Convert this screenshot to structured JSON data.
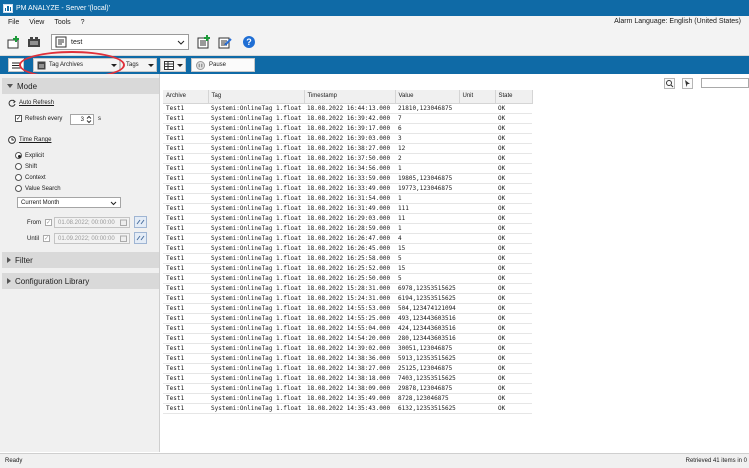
{
  "window": {
    "title": "PM ANALYZE - Server '(local)'"
  },
  "menu": {
    "items": [
      "File",
      "View",
      "Tools",
      "?"
    ],
    "alarm_language": "Alarm Language: English (United States)"
  },
  "toolbar": {
    "project_combo_value": "test"
  },
  "toolbar2": {
    "source_dropdown": "Tag Archives",
    "tags_dropdown": "Tags",
    "pause_label": "Pause"
  },
  "mode_panel": {
    "header": "Mode",
    "auto_refresh": "Auto Refresh",
    "refresh_every_label": "Refresh every",
    "refresh_value": "3",
    "refresh_unit": "s",
    "time_range": "Time Range",
    "options": [
      "Explicit",
      "Shift",
      "Context",
      "Value Search"
    ],
    "selected_option": "Explicit",
    "range_preset": "Current Month",
    "from_label": "From",
    "from_value": "01.08.2022; 00:00:00",
    "until_label": "Until",
    "until_value": "01.09.2022; 00:00:00"
  },
  "filter_panel": {
    "header": "Filter"
  },
  "config_panel": {
    "header": "Configuration Library"
  },
  "table": {
    "columns": [
      "Archive",
      "Tag",
      "Timestamp",
      "Value",
      "Unit",
      "State"
    ],
    "rows": [
      [
        "Test1",
        "Systemi:OnlineTag 1.float",
        "18.08.2022 16:44:13.000",
        "21810,123046875",
        "",
        "OK"
      ],
      [
        "Test1",
        "Systemi:OnlineTag 1.float",
        "18.08.2022 16:39:42.000",
        "7",
        "",
        "OK"
      ],
      [
        "Test1",
        "Systemi:OnlineTag 1.float",
        "18.08.2022 16:39:17.000",
        "6",
        "",
        "OK"
      ],
      [
        "Test1",
        "Systemi:OnlineTag 1.float",
        "18.08.2022 16:39:03.000",
        "3",
        "",
        "OK"
      ],
      [
        "Test1",
        "Systemi:OnlineTag 1.float",
        "18.08.2022 16:38:27.000",
        "12",
        "",
        "OK"
      ],
      [
        "Test1",
        "Systemi:OnlineTag 1.float",
        "18.08.2022 16:37:50.000",
        "2",
        "",
        "OK"
      ],
      [
        "Test1",
        "Systemi:OnlineTag 1.float",
        "18.08.2022 16:34:56.000",
        "1",
        "",
        "OK"
      ],
      [
        "Test1",
        "Systemi:OnlineTag 1.float",
        "18.08.2022 16:33:59.000",
        "19805,123046875",
        "",
        "OK"
      ],
      [
        "Test1",
        "Systemi:OnlineTag 1.float",
        "18.08.2022 16:33:49.000",
        "19773,123046875",
        "",
        "OK"
      ],
      [
        "Test1",
        "Systemi:OnlineTag 1.float",
        "18.08.2022 16:31:54.000",
        "1",
        "",
        "OK"
      ],
      [
        "Test1",
        "Systemi:OnlineTag 1.float",
        "18.08.2022 16:31:49.000",
        "111",
        "",
        "OK"
      ],
      [
        "Test1",
        "Systemi:OnlineTag 1.float",
        "18.08.2022 16:29:03.000",
        "11",
        "",
        "OK"
      ],
      [
        "Test1",
        "Systemi:OnlineTag 1.float",
        "18.08.2022 16:28:59.000",
        "1",
        "",
        "OK"
      ],
      [
        "Test1",
        "Systemi:OnlineTag 1.float",
        "18.08.2022 16:26:47.000",
        "4",
        "",
        "OK"
      ],
      [
        "Test1",
        "Systemi:OnlineTag 1.float",
        "18.08.2022 16:26:45.000",
        "15",
        "",
        "OK"
      ],
      [
        "Test1",
        "Systemi:OnlineTag 1.float",
        "18.08.2022 16:25:58.000",
        "5",
        "",
        "OK"
      ],
      [
        "Test1",
        "Systemi:OnlineTag 1.float",
        "18.08.2022 16:25:52.000",
        "15",
        "",
        "OK"
      ],
      [
        "Test1",
        "Systemi:OnlineTag 1.float",
        "18.08.2022 16:25:50.000",
        "5",
        "",
        "OK"
      ],
      [
        "Test1",
        "Systemi:OnlineTag 1.float",
        "18.08.2022 15:28:31.000",
        "6978,12353515625",
        "",
        "OK"
      ],
      [
        "Test1",
        "Systemi:OnlineTag 1.float",
        "18.08.2022 15:24:31.000",
        "6194,12353515625",
        "",
        "OK"
      ],
      [
        "Test1",
        "Systemi:OnlineTag 1.float",
        "18.08.2022 14:55:53.000",
        "504,123474121094",
        "",
        "OK"
      ],
      [
        "Test1",
        "Systemi:OnlineTag 1.float",
        "18.08.2022 14:55:25.000",
        "493,123443603516",
        "",
        "OK"
      ],
      [
        "Test1",
        "Systemi:OnlineTag 1.float",
        "18.08.2022 14:55:04.000",
        "424,123443603516",
        "",
        "OK"
      ],
      [
        "Test1",
        "Systemi:OnlineTag 1.float",
        "18.08.2022 14:54:20.000",
        "280,123443603516",
        "",
        "OK"
      ],
      [
        "Test1",
        "Systemi:OnlineTag 1.float",
        "18.08.2022 14:39:02.000",
        "30051,123046875",
        "",
        "OK"
      ],
      [
        "Test1",
        "Systemi:OnlineTag 1.float",
        "18.08.2022 14:38:36.000",
        "5913,12353515625",
        "",
        "OK"
      ],
      [
        "Test1",
        "Systemi:OnlineTag 1.float",
        "18.08.2022 14:38:27.000",
        "25125,123046875",
        "",
        "OK"
      ],
      [
        "Test1",
        "Systemi:OnlineTag 1.float",
        "18.08.2022 14:38:18.000",
        "7403,12353515625",
        "",
        "OK"
      ],
      [
        "Test1",
        "Systemi:OnlineTag 1.float",
        "18.08.2022 14:38:09.000",
        "29878,123046875",
        "",
        "OK"
      ],
      [
        "Test1",
        "Systemi:OnlineTag 1.float",
        "18.08.2022 14:35:49.000",
        "8728,123046875",
        "",
        "OK"
      ],
      [
        "Test1",
        "Systemi:OnlineTag 1.float",
        "18.08.2022 14:35:43.000",
        "6132,12353515625",
        "",
        "OK"
      ]
    ]
  },
  "status": {
    "left": "Ready",
    "right": "Retrieved 41 items in 0"
  },
  "colors": {
    "accent": "#0f6aa6",
    "highlight_circle": "#e0303a"
  }
}
